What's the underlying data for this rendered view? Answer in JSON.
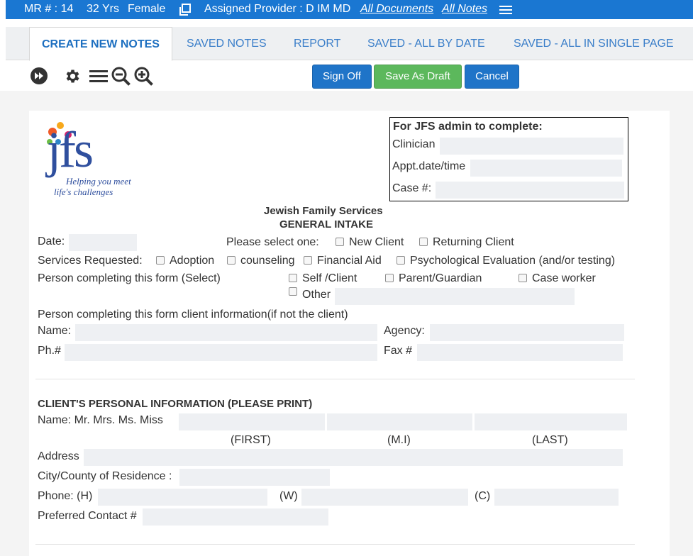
{
  "topbar": {
    "mr": "MR # : 14",
    "age": "32 Yrs",
    "gender": "Female",
    "provider": "Assigned Provider : D IM MD",
    "all_documents": "All Documents",
    "all_notes": "All Notes"
  },
  "tabs": [
    {
      "label": "CREATE NEW NOTES",
      "active": true
    },
    {
      "label": "SAVED NOTES"
    },
    {
      "label": "REPORT"
    },
    {
      "label": "SAVED - ALL BY DATE"
    },
    {
      "label": "SAVED - ALL IN SINGLE PAGE"
    }
  ],
  "toolbar": {
    "sign_off": "Sign Off",
    "save_draft": "Save As Draft",
    "cancel": "Cancel"
  },
  "logo": {
    "text": "jfs",
    "tagline1": "Helping you meet",
    "tagline2": "life's challenges"
  },
  "admin": {
    "title": "For JFS admin to complete:",
    "clinician": "Clinician",
    "appt": "Appt.date/time",
    "case": "Case #:"
  },
  "form": {
    "org": "Jewish Family Services",
    "title": "GENERAL INTAKE",
    "date": "Date:",
    "select_one": "Please select one:",
    "new_client": "New Client",
    "returning_client": "Returning Client",
    "services": "Services Requested:",
    "adoption": "Adoption",
    "counseling": "counseling",
    "financial_aid": "Financial Aid",
    "psych_eval": "Psychological Evaluation (and/or testing)",
    "completing": "Person completing this form (Select)",
    "self_client": "Self /Client",
    "parent": "Parent/Guardian",
    "case_worker": "Case worker",
    "other": "Other",
    "completing_info": "Person completing this form client information(if not the client)",
    "name": "Name:",
    "agency": "Agency:",
    "phone": "Ph.#",
    "fax": "Fax #",
    "personal_header": "CLIENT'S PERSONAL INFORMATION (PLEASE PRINT)",
    "client_name": "Name: Mr. Mrs. Ms. Miss",
    "first": "(FIRST)",
    "mi": "(M.I)",
    "last": "(LAST)",
    "address": "Address",
    "city": "City/County of Residence :",
    "phone_h": "Phone: (H)",
    "phone_w": "(W)",
    "phone_c": "(C)",
    "preferred": "Preferred Contact #"
  },
  "colors": {
    "topbar": "#1a77d2",
    "button_blue": "#1f74c8",
    "button_green": "#5cb85c",
    "logo_blue": "#2f4f9e"
  }
}
